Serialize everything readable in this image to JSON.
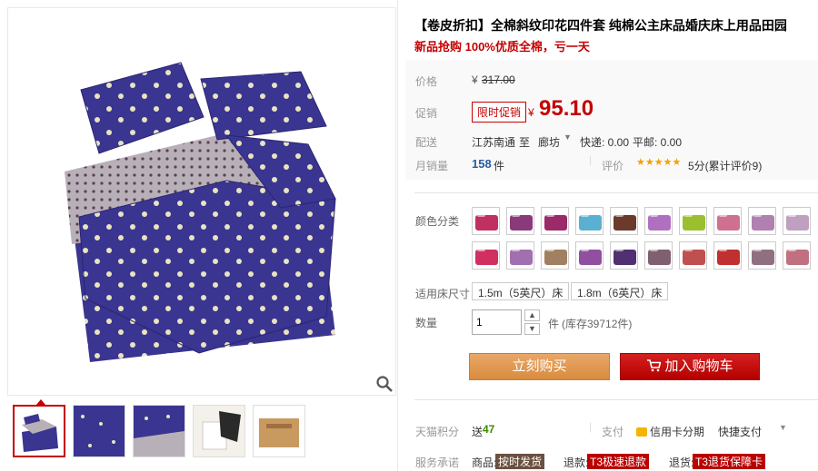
{
  "product": {
    "title": "【卷皮折扣】全棉斜纹印花四件套 纯棉公主床品婚庆床上用品田园",
    "subtitle": "新品抢购 100%优质全棉，亏一天"
  },
  "price": {
    "label": "价格",
    "currency": "¥",
    "original": "317.00",
    "promo_label": "促销",
    "promo_badge": "限时促销",
    "current": "95.10"
  },
  "shipping": {
    "label": "配送",
    "from": "江苏南通",
    "to_word": "至",
    "to": "廊坊",
    "express": "快递: 0.00",
    "mail": "平邮: 0.00"
  },
  "sales": {
    "label": "月销量",
    "count": "158",
    "unit": "件",
    "rating_label": "评价",
    "stars": "★★★★★",
    "rating_text": "5分(累计评价9)"
  },
  "color": {
    "label": "颜色分类",
    "swatches": [
      "#c03060",
      "#8a3a7a",
      "#9a2a6a",
      "#5ab0d0",
      "#6a3a2a",
      "#b070c0",
      "#9ac030",
      "#d07090",
      "#b080b0",
      "#c0a0c0",
      "#d03060",
      "#a070b0",
      "#a08060",
      "#9050a0",
      "#503070",
      "#806070",
      "#c05050",
      "#c03030",
      "#907080",
      "#c07080"
    ]
  },
  "size": {
    "label": "适用床尺寸",
    "options": [
      "1.5m（5英尺）床",
      "1.8m（6英尺）床"
    ]
  },
  "quantity": {
    "label": "数量",
    "value": "1",
    "unit": "件",
    "stock": "(库存39712件)"
  },
  "actions": {
    "buy": "立刻购买",
    "cart": "加入购物车"
  },
  "points": {
    "label": "天猫积分",
    "prefix": "送",
    "value": "47",
    "pay_label": "支付",
    "credit": "信用卡分期",
    "quick": "快捷支付"
  },
  "service": {
    "label": "服务承诺",
    "goods_label": "商品:",
    "goods_tag": "按时发货",
    "refund_label": "退款:",
    "refund_tag": "T3极速退款",
    "return_label": "退货:",
    "return_tag": "T3退货保障卡"
  }
}
